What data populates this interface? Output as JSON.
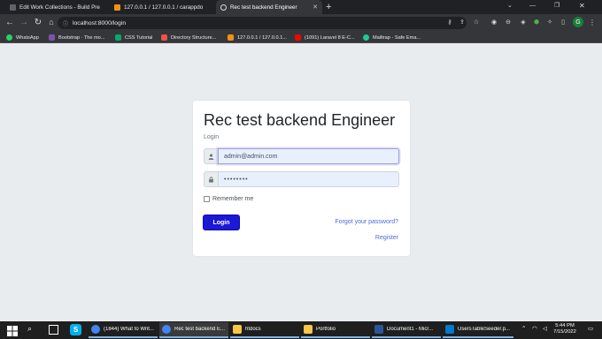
{
  "browser": {
    "tabs": [
      {
        "title": "Edit Work Collections - Build Pre",
        "icon": "document-icon",
        "active": false
      },
      {
        "title": "127.0.0.1 / 127.0.0.1 / carappdo",
        "icon": "phpmyadmin-icon",
        "active": false
      },
      {
        "title": "Rec test backend Engineer",
        "icon": "globe-icon",
        "active": true
      }
    ],
    "new_tab_label": "+",
    "address": "localhost:8000/login",
    "profile_initial": "G"
  },
  "bookmarks": [
    {
      "label": "WhatsApp",
      "icon": "whatsapp-icon",
      "color": "#25d366"
    },
    {
      "label": "Bootstrap · The mo...",
      "icon": "bootstrap-icon",
      "color": "#7952b3"
    },
    {
      "label": "CSS Tutorial",
      "icon": "w3schools-icon",
      "color": "#04aa6d"
    },
    {
      "label": "Directory Structure...",
      "icon": "laravel-icon",
      "color": "#f05340"
    },
    {
      "label": "127.0.0.1 / 127.0.0.1...",
      "icon": "phpmyadmin-icon",
      "color": "#f29111"
    },
    {
      "label": "(1091) Laravel 8 E-C...",
      "icon": "youtube-icon",
      "color": "#ff0000"
    },
    {
      "label": "Mailtrap - Safe Ema...",
      "icon": "mailtrap-icon",
      "color": "#22c993"
    }
  ],
  "login": {
    "title": "Rec test backend Engineer",
    "subtitle": "Login",
    "email_value": "admin@admin.com",
    "password_value": "••••••••",
    "remember_label": "Remember me",
    "submit_label": "Login",
    "forgot_label": "Forgot your password?",
    "register_label": "Register"
  },
  "taskbar": {
    "apps": [
      {
        "label": "(1844) What to Writ...",
        "icon": "chrome-icon"
      },
      {
        "label": "Rec test backend E...",
        "icon": "chrome-icon"
      },
      {
        "label": "htdocs",
        "icon": "folder-icon"
      },
      {
        "label": "Portfolio",
        "icon": "folder-icon"
      },
      {
        "label": "Document1 - Micr...",
        "icon": "word-icon"
      },
      {
        "label": "UsersTableSeeder.p...",
        "icon": "vscode-icon"
      }
    ],
    "time": "5:44 PM",
    "date": "7/15/2022"
  },
  "colors": {
    "accent": "#1b18d6",
    "link": "#4b6cd6",
    "input_autofill": "#e8f0fe"
  }
}
